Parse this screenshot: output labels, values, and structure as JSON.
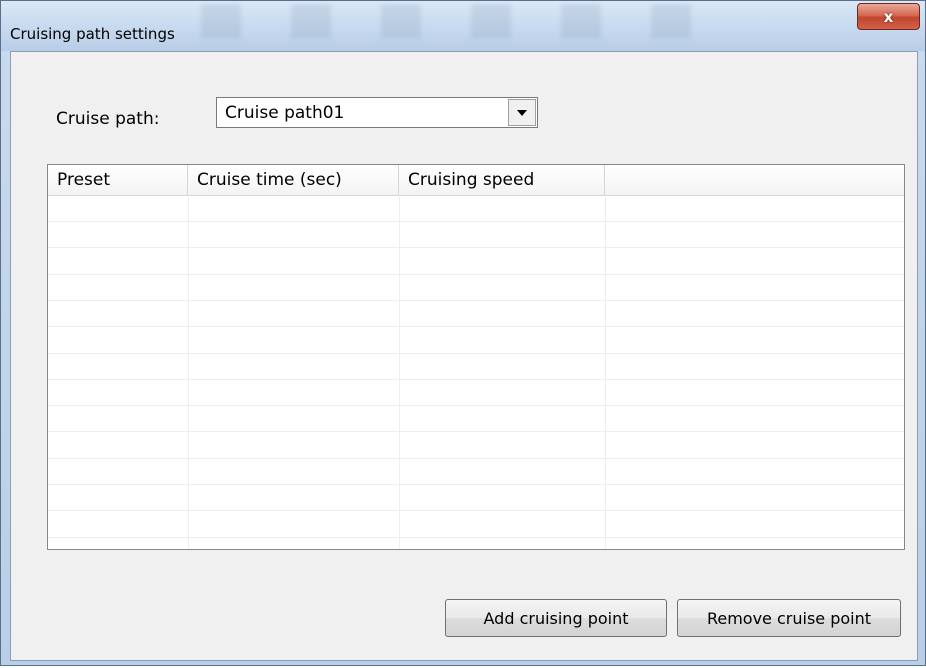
{
  "window": {
    "title": "Cruising path settings",
    "close_label": "x"
  },
  "form": {
    "cruise_path_label": "Cruise path:",
    "cruise_path_value": "Cruise path01"
  },
  "table": {
    "columns": [
      "Preset",
      "Cruise time (sec)",
      "Cruising speed",
      ""
    ],
    "rows": []
  },
  "buttons": {
    "add_label": "Add cruising point",
    "remove_label": "Remove cruise point"
  },
  "icons": {
    "dropdown": "chevron-down-icon",
    "close": "close-icon"
  }
}
